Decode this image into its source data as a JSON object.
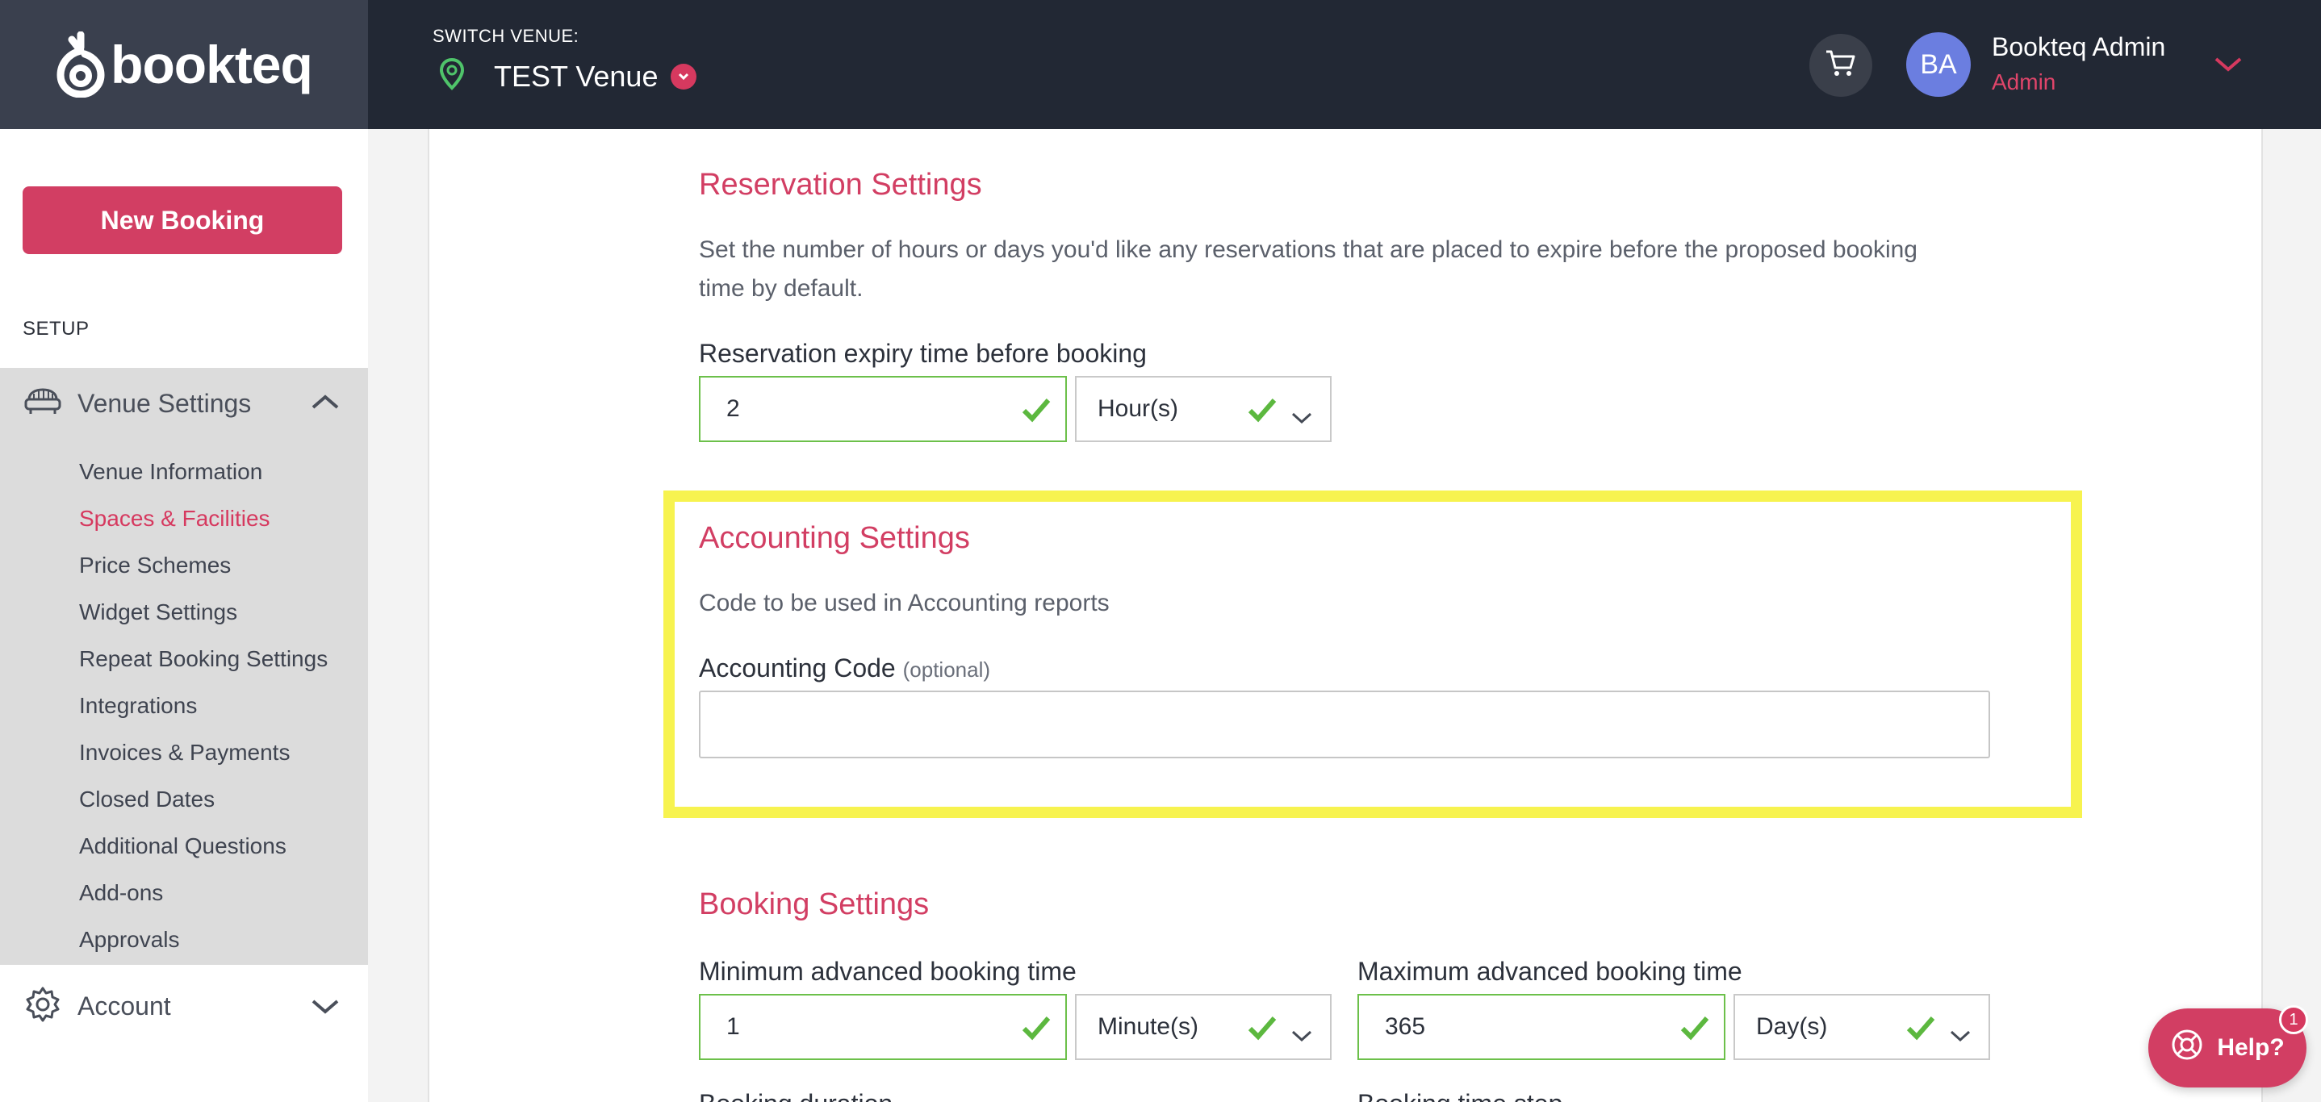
{
  "brand": {
    "name": "bookteq"
  },
  "header": {
    "switch_label": "SWITCH VENUE:",
    "venue_name": "TEST Venue",
    "user_initials": "BA",
    "user_name": "Bookteq Admin",
    "user_role": "Admin"
  },
  "sidebar": {
    "new_booking": "New Booking",
    "setup_label": "SETUP",
    "venue_settings": {
      "label": "Venue Settings",
      "items": [
        {
          "label": "Venue Information"
        },
        {
          "label": "Spaces & Facilities",
          "active": true
        },
        {
          "label": "Price Schemes"
        },
        {
          "label": "Widget Settings"
        },
        {
          "label": "Repeat Booking Settings"
        },
        {
          "label": "Integrations"
        },
        {
          "label": "Invoices & Payments"
        },
        {
          "label": "Closed Dates"
        },
        {
          "label": "Additional Questions"
        },
        {
          "label": "Add-ons"
        },
        {
          "label": "Approvals"
        }
      ]
    },
    "account": {
      "label": "Account"
    }
  },
  "reservation": {
    "title": "Reservation Settings",
    "description": "Set the number of hours or days you'd like any reservations that are placed to expire before the proposed booking time by default.",
    "expiry_label": "Reservation expiry time before booking",
    "expiry_value": "2",
    "expiry_unit": "Hour(s)"
  },
  "accounting": {
    "title": "Accounting Settings",
    "description": "Code to be used in Accounting reports",
    "code_label": "Accounting Code",
    "code_optional": "(optional)",
    "code_value": ""
  },
  "booking": {
    "title": "Booking Settings",
    "min_label": "Minimum advanced booking time",
    "min_value": "1",
    "min_unit": "Minute(s)",
    "max_label": "Maximum advanced booking time",
    "max_value": "365",
    "max_unit": "Day(s)",
    "cut_left": "Booking duration",
    "cut_right": "Booking time step"
  },
  "help": {
    "label": "Help?",
    "badge": "1"
  },
  "colors": {
    "accent": "#d23e63",
    "header_bg": "#222834",
    "valid_green": "#6cc04a",
    "highlight": "#f7f34f"
  }
}
